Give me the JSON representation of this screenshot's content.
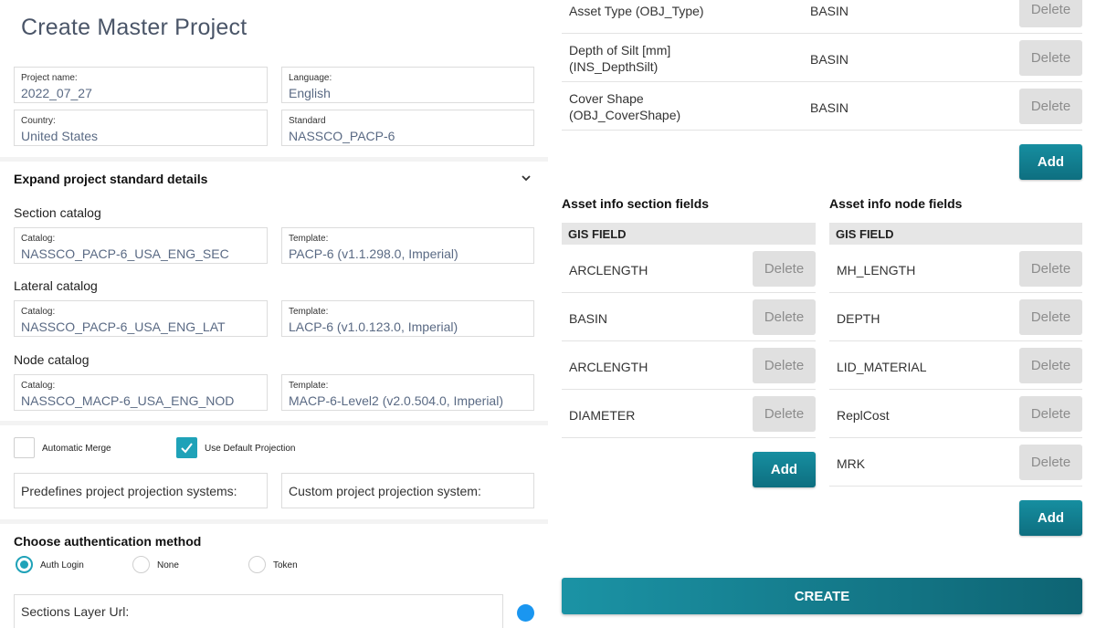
{
  "page_title": "Create Master Project",
  "project": {
    "name_label": "Project name:",
    "name_value": "2022_07_27",
    "language_label": "Language:",
    "language_value": "English",
    "country_label": "Country:",
    "country_value": "United States",
    "standard_label": "Standard",
    "standard_value": "NASSCO_PACP-6"
  },
  "expand_label": "Expand project standard details",
  "catalogs": {
    "section": {
      "title": "Section catalog",
      "catalog_label": "Catalog:",
      "catalog_value": "NASSCO_PACP-6_USA_ENG_SEC",
      "template_label": "Template:",
      "template_value": "PACP-6 (v1.1.298.0, Imperial)"
    },
    "lateral": {
      "title": "Lateral catalog",
      "catalog_label": "Catalog:",
      "catalog_value": "NASSCO_PACP-6_USA_ENG_LAT",
      "template_label": "Template:",
      "template_value": "LACP-6 (v1.0.123.0, Imperial)"
    },
    "node": {
      "title": "Node catalog",
      "catalog_label": "Catalog:",
      "catalog_value": "NASSCO_MACP-6_USA_ENG_NOD",
      "template_label": "Template:",
      "template_value": "MACP-6-Level2 (v2.0.504.0, Imperial)"
    }
  },
  "options": {
    "automatic_merge": {
      "label": "Automatic Merge",
      "checked": false
    },
    "use_default_projection": {
      "label": "Use Default Projection",
      "checked": true
    }
  },
  "projection": {
    "predefined_label": "Predefines project projection systems:",
    "custom_label": "Custom project projection system:"
  },
  "auth": {
    "title": "Choose authentication method",
    "options": [
      {
        "label": "Auth Login",
        "selected": true
      },
      {
        "label": "None",
        "selected": false
      },
      {
        "label": "Token",
        "selected": false
      }
    ]
  },
  "sections_layer_url_label": "Sections Layer Url:",
  "top_fields": [
    {
      "name": "Asset Type (OBJ_Type)",
      "value": "BASIN"
    },
    {
      "name": "Depth of Silt [mm]\n(INS_DepthSilt)",
      "value": "BASIN"
    },
    {
      "name": "Cover Shape\n(OBJ_CoverShape)",
      "value": "BASIN"
    }
  ],
  "delete_label": "Delete",
  "add_label": "Add",
  "section_fields": {
    "title": "Asset info section fields",
    "header": "GIS FIELD",
    "rows": [
      "ARCLENGTH",
      "BASIN",
      "ARCLENGTH",
      "DIAMETER"
    ]
  },
  "node_fields": {
    "title": "Asset info node fields",
    "header": "GIS FIELD",
    "rows": [
      "MH_LENGTH",
      "DEPTH",
      "LID_MATERIAL",
      "ReplCost",
      "MRK"
    ]
  },
  "create_label": "CREATE",
  "colors": {
    "accent": "#1fa2b8",
    "button_dark": "#0e6f80",
    "dot": "#1a96f0"
  }
}
